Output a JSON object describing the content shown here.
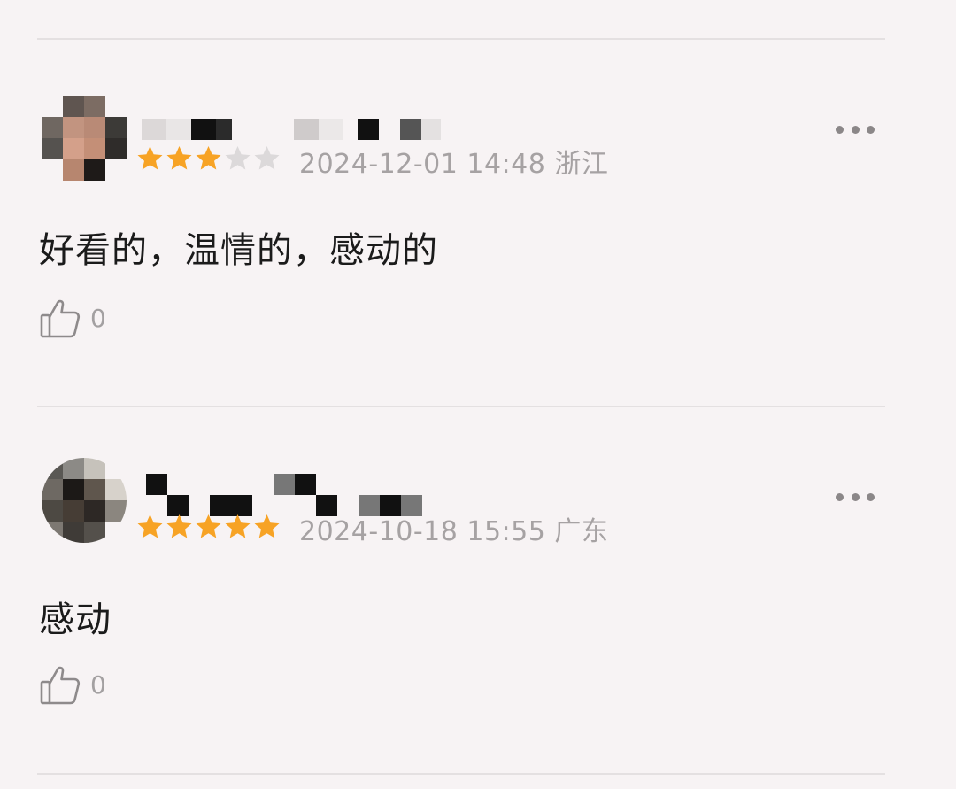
{
  "reviews": [
    {
      "rating": 3,
      "max_rating": 5,
      "date": "2024-12-01 14:48",
      "location": "浙江",
      "content": "好看的，温情的，感动的",
      "like_count": "0",
      "more_icon": "more-horizontal-icon",
      "like_icon": "thumbs-up-icon"
    },
    {
      "rating": 5,
      "max_rating": 5,
      "date": "2024-10-18 15:55",
      "location": "广东",
      "content": "感动",
      "like_count": "0",
      "more_icon": "more-horizontal-icon",
      "like_icon": "thumbs-up-icon"
    }
  ],
  "colors": {
    "background": "#f7f3f4",
    "star_filled": "#f7a325",
    "star_empty": "#dcd9da",
    "meta_text": "#a6a2a3",
    "divider": "#e4e0e1"
  }
}
